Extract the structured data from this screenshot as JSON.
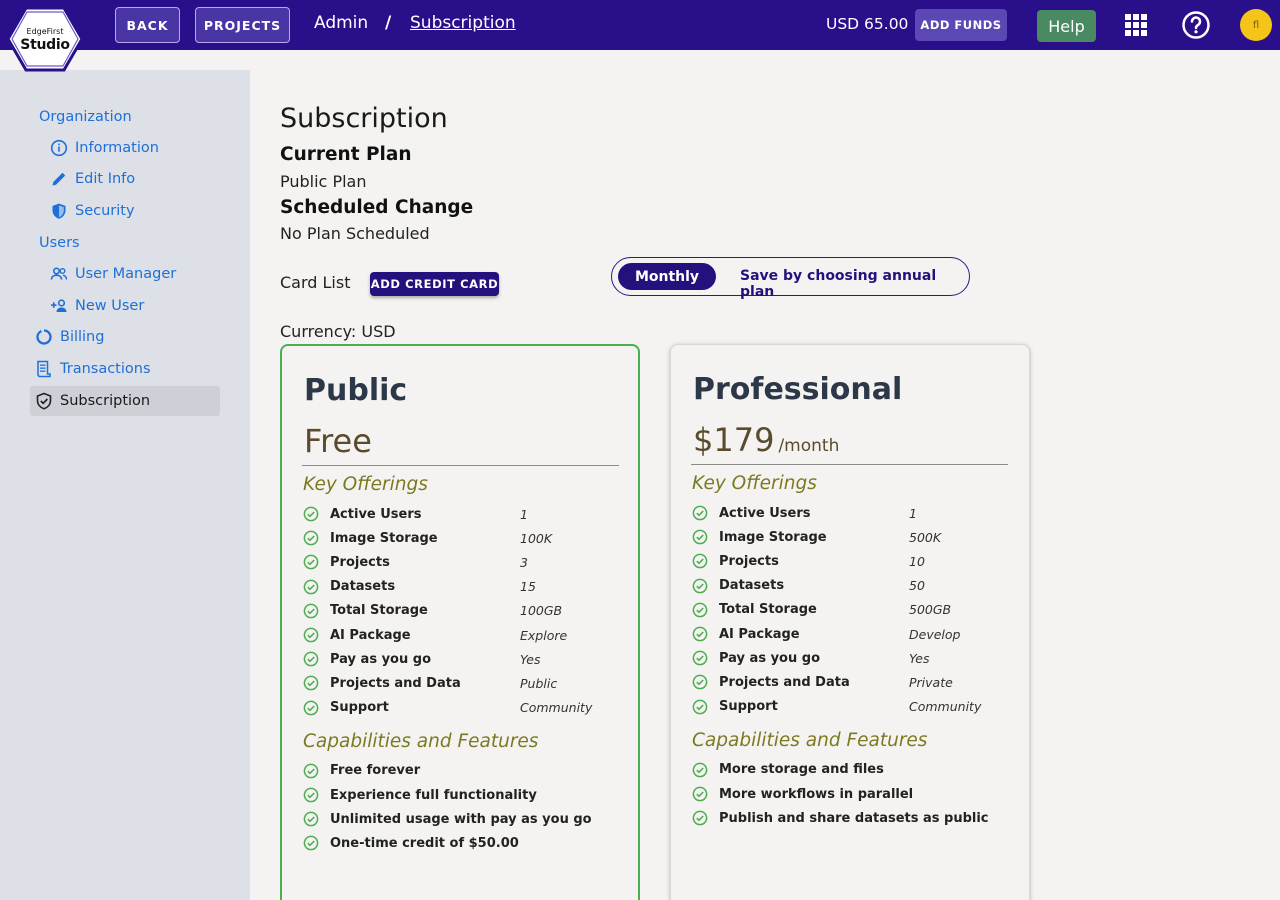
{
  "topbar": {
    "logo_small": "EdgeFirst",
    "logo_big": "Studio",
    "back_label": "BACK",
    "projects_label": "PROJECTS",
    "crumb_root": "Admin",
    "crumb_sep": "/",
    "crumb_current": "Subscription",
    "balance": "USD 65.00",
    "add_funds_label": "ADD FUNDS",
    "help_label": "Help",
    "avatar_initials": "fl"
  },
  "sidebar": {
    "org_header": "Organization",
    "information": "Information",
    "edit_info": "Edit Info",
    "security": "Security",
    "users_header": "Users",
    "user_manager": "User Manager",
    "new_user": "New User",
    "billing": "Billing",
    "transactions": "Transactions",
    "subscription": "Subscription"
  },
  "main": {
    "title": "Subscription",
    "current_plan_label": "Current Plan",
    "current_plan_value": "Public Plan",
    "scheduled_label": "Scheduled Change",
    "scheduled_value": "No Plan Scheduled",
    "card_list_label": "Card List",
    "add_card_label": "ADD CREDIT CARD",
    "toggle_monthly": "Monthly",
    "toggle_annual": "Save by choosing annual plan",
    "currency": "Currency: USD"
  },
  "plans": [
    {
      "name": "Public",
      "price": "Free",
      "period": "",
      "key_title": "Key Offerings",
      "offerings": [
        {
          "k": "Active Users",
          "v": "1"
        },
        {
          "k": "Image Storage",
          "v": "100K"
        },
        {
          "k": "Projects",
          "v": "3"
        },
        {
          "k": "Datasets",
          "v": "15"
        },
        {
          "k": "Total Storage",
          "v": "100GB"
        },
        {
          "k": "AI Package",
          "v": "Explore"
        },
        {
          "k": "Pay as you go",
          "v": "Yes"
        },
        {
          "k": "Projects and Data",
          "v": "Public"
        },
        {
          "k": "Support",
          "v": "Community"
        }
      ],
      "cap_title": "Capabilities and Features",
      "capabilities": [
        "Free forever",
        "Experience full functionality",
        "Unlimited usage with pay as you go",
        "One-time credit of $50.00"
      ]
    },
    {
      "name": "Professional",
      "price": "$179",
      "period": "/month",
      "key_title": "Key Offerings",
      "offerings": [
        {
          "k": "Active Users",
          "v": "1"
        },
        {
          "k": "Image Storage",
          "v": "500K"
        },
        {
          "k": "Projects",
          "v": "10"
        },
        {
          "k": "Datasets",
          "v": "50"
        },
        {
          "k": "Total Storage",
          "v": "500GB"
        },
        {
          "k": "AI Package",
          "v": "Develop"
        },
        {
          "k": "Pay as you go",
          "v": "Yes"
        },
        {
          "k": "Projects and Data",
          "v": "Private"
        },
        {
          "k": "Support",
          "v": "Community"
        }
      ],
      "cap_title": "Capabilities and Features",
      "capabilities": [
        "More storage and files",
        "More workflows in parallel",
        "Publish and share datasets as public"
      ]
    }
  ],
  "colors": {
    "topbar": "#2a0f8a",
    "accent": "#24117d",
    "link": "#1e6fd9",
    "selected_border": "#4caf50",
    "check": "#4caf50"
  }
}
